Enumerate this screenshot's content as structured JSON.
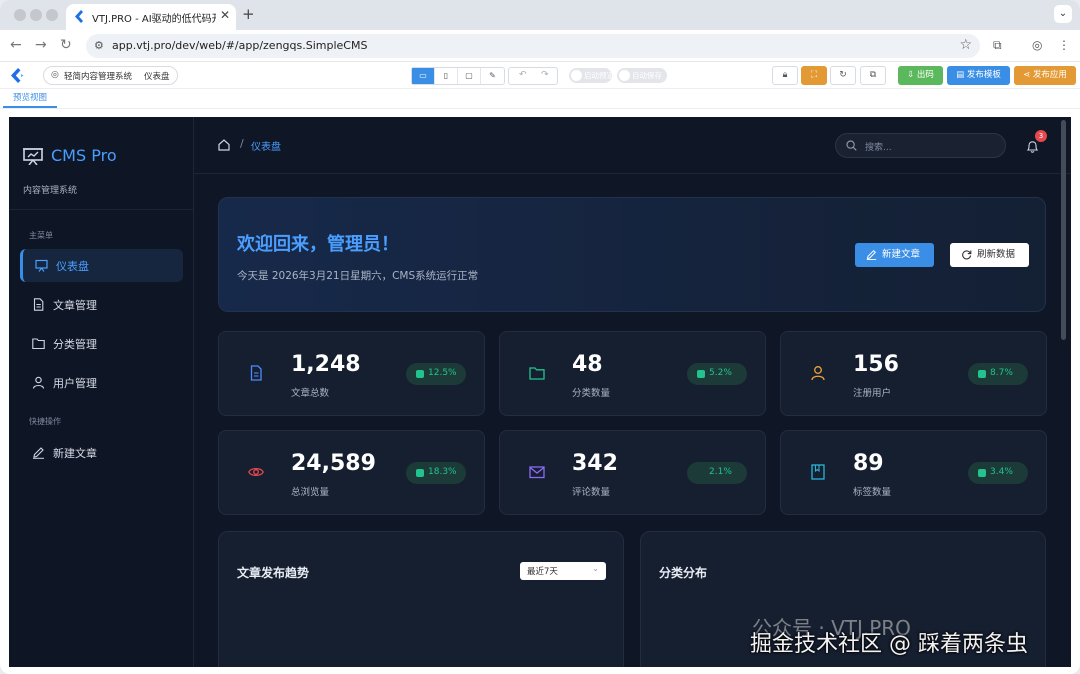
{
  "browser": {
    "tab_title": "VTJ.PRO - AI驱动的低代码开发",
    "tab_close": "✕",
    "new_tab": "+",
    "url": "app.vtj.pro/dev/web/#/app/zengqs.SimpleCMS"
  },
  "vtj": {
    "breadcrumb_app": "轻简内容管理系统",
    "breadcrumb_page": "仪表盘",
    "toggle1": "启动预览",
    "toggle2": "自动保存",
    "btn_code": "出码",
    "btn_template": "发布模板",
    "btn_publish": "发布应用",
    "preview_tab": "预览视图",
    "colors": {
      "code": "#5cb85c",
      "template": "#3a8ee6",
      "publish": "#e39a34"
    }
  },
  "sidebar": {
    "brand": "CMS Pro",
    "subtitle": "内容管理系统",
    "section_main": "主菜单",
    "section_quick": "快捷操作",
    "items": [
      {
        "label": "仪表盘",
        "icon": "monitor-icon",
        "active": true
      },
      {
        "label": "文章管理",
        "icon": "document-icon"
      },
      {
        "label": "分类管理",
        "icon": "folder-icon"
      },
      {
        "label": "用户管理",
        "icon": "user-icon"
      }
    ],
    "quick": [
      {
        "label": "新建文章",
        "icon": "edit-icon"
      }
    ]
  },
  "header": {
    "breadcrumb_sep": "/",
    "breadcrumb_current": "仪表盘",
    "search_placeholder": "搜索...",
    "notification_count": "3"
  },
  "welcome": {
    "title": "欢迎回来，管理员！",
    "subtitle": "今天是 2026年3月21日星期六，CMS系统运行正常",
    "btn_new": "新建文章",
    "btn_refresh": "刷新数据"
  },
  "stats": [
    {
      "value": "1,248",
      "label": "文章总数",
      "trend": "12.5%",
      "icon": "document-icon",
      "color": "#4a8cff"
    },
    {
      "value": "48",
      "label": "分类数量",
      "trend": "5.2%",
      "icon": "folder-icon",
      "color": "#22c38e"
    },
    {
      "value": "156",
      "label": "注册用户",
      "trend": "8.7%",
      "icon": "user-icon",
      "color": "#f0a23a"
    },
    {
      "value": "24,589",
      "label": "总浏览量",
      "trend": "18.3%",
      "icon": "eye-icon",
      "color": "#e5484d"
    },
    {
      "value": "342",
      "label": "评论数量",
      "trend": "2.1%",
      "icon": "mail-icon",
      "color": "#8b6cf6"
    },
    {
      "value": "89",
      "label": "标签数量",
      "trend": "3.4%",
      "icon": "bookmark-icon",
      "color": "#29b6d8"
    }
  ],
  "panels": {
    "trend_title": "文章发布趋势",
    "trend_range": "最近7天",
    "category_title": "分类分布"
  },
  "watermark": {
    "line1": "公众号 · VTJ.PRO",
    "line2": "掘金技术社区 @ 踩着两条虫"
  }
}
